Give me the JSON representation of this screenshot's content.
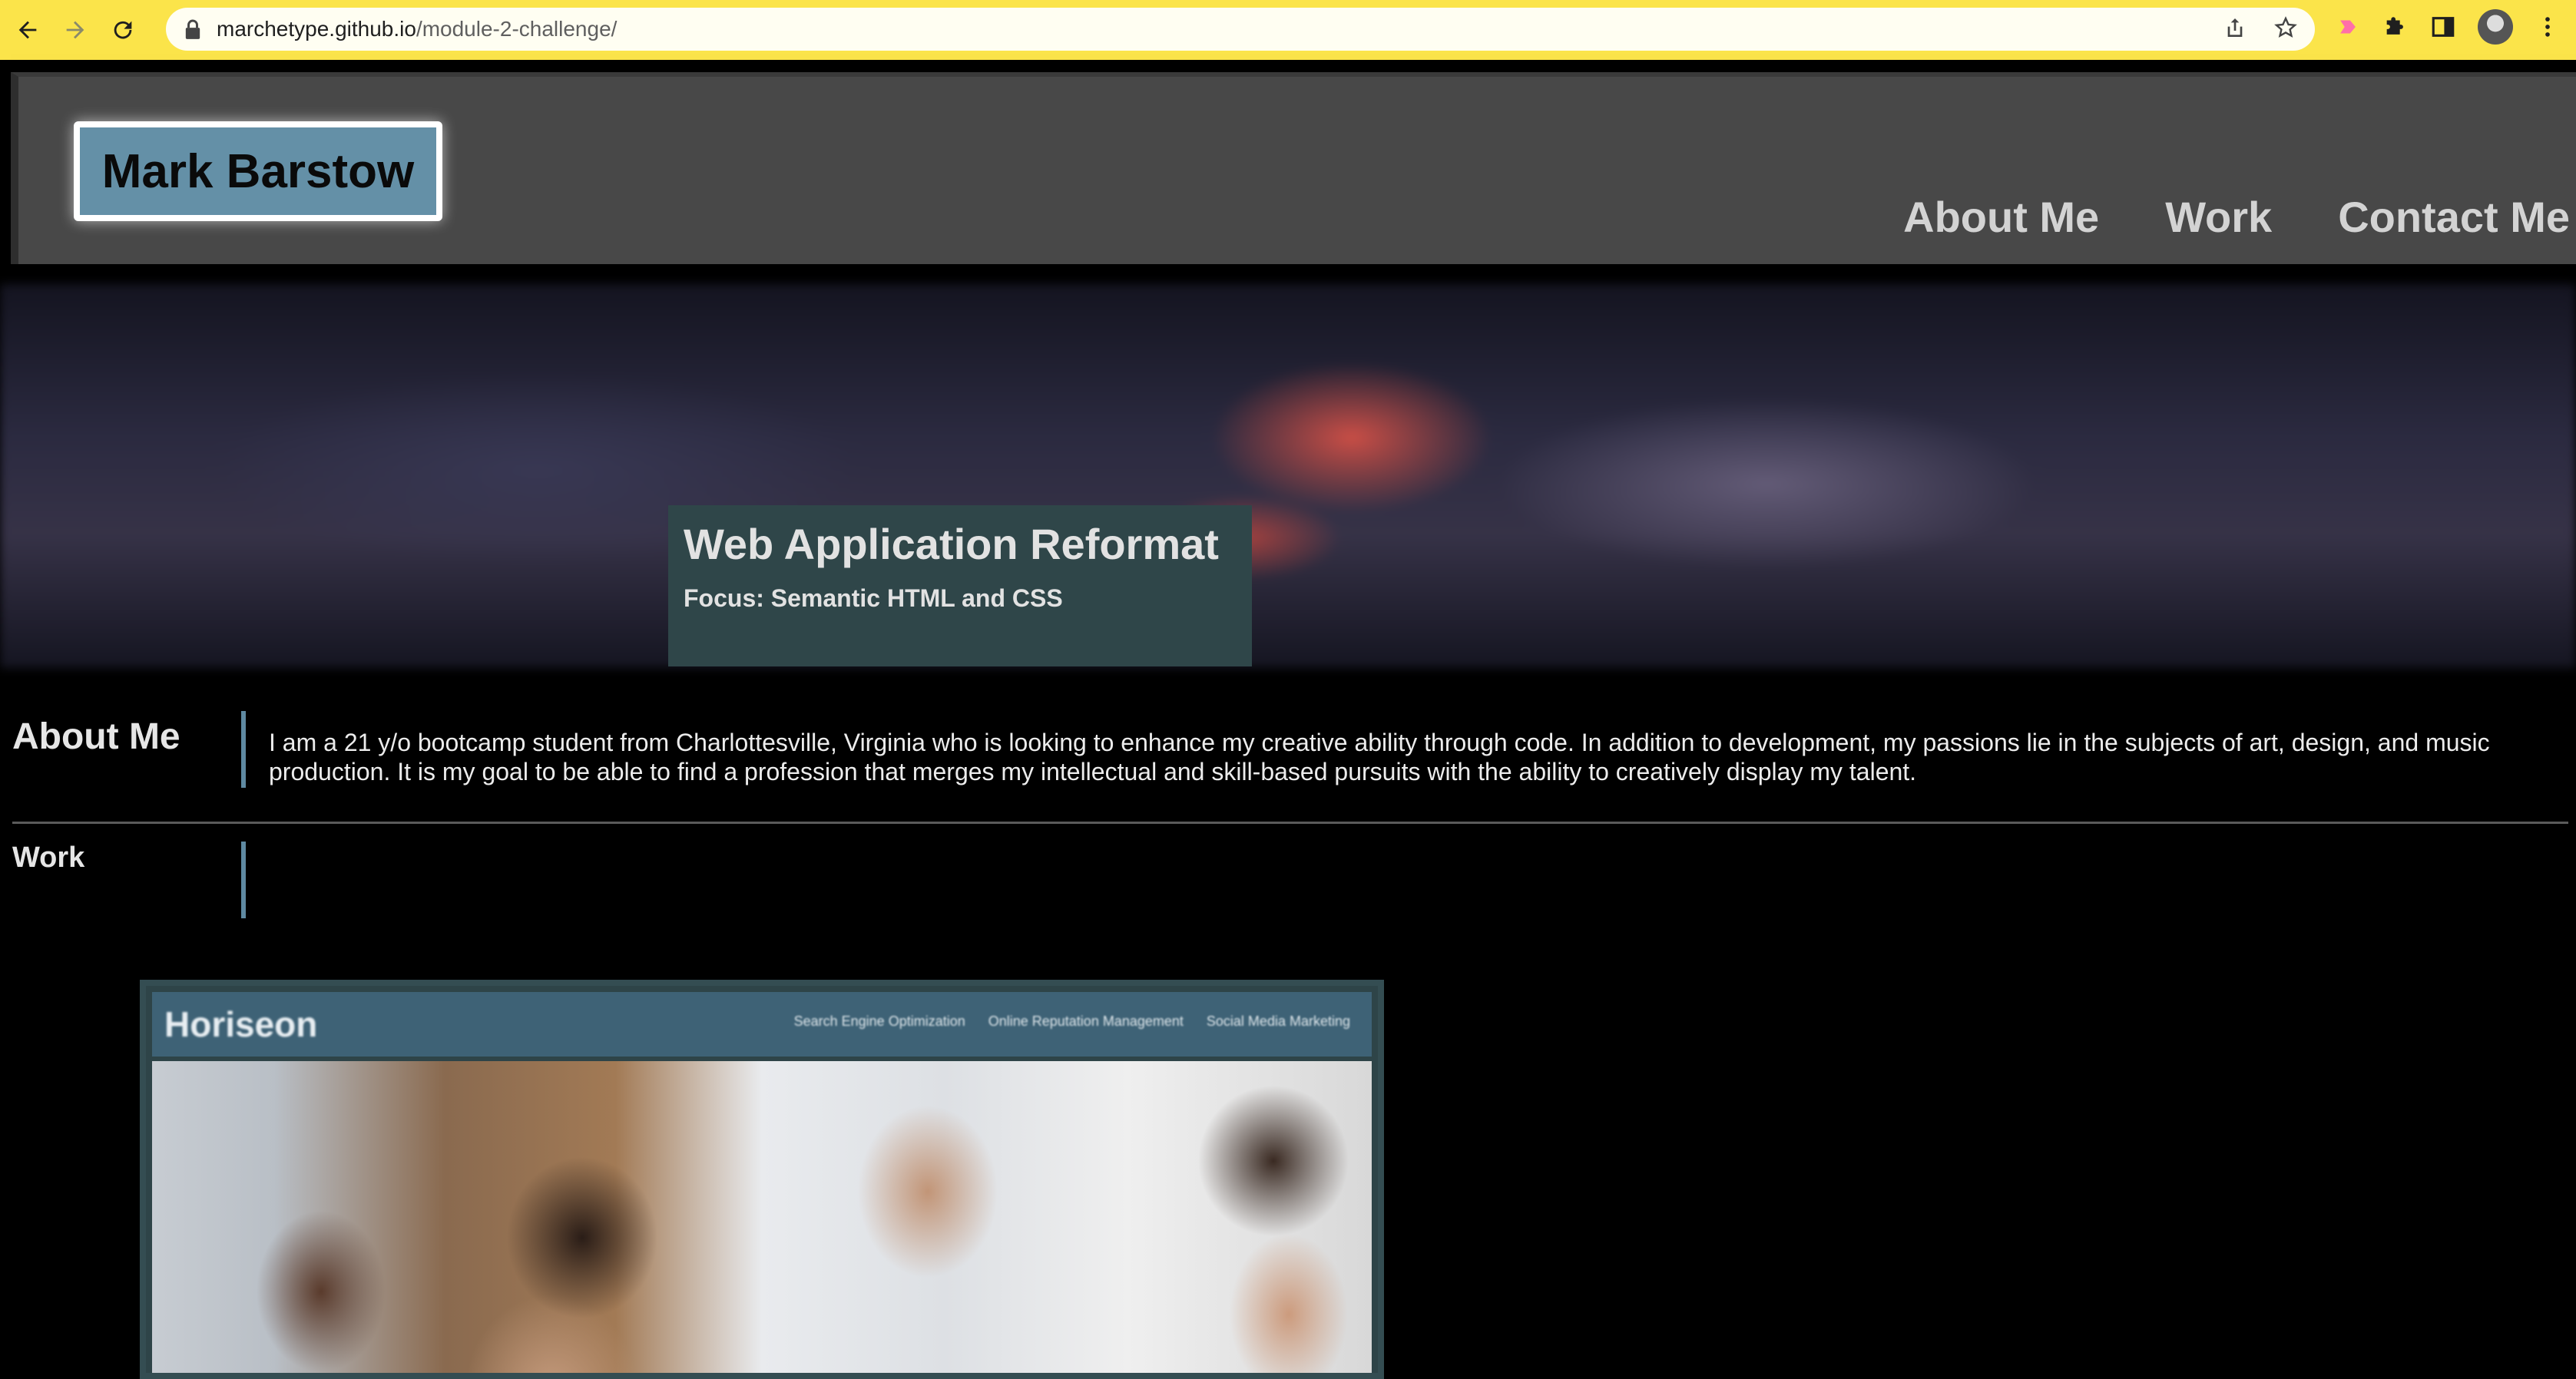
{
  "browser": {
    "url_host": "marchetype.github.io",
    "url_path": "/module-2-challenge/",
    "toolbar_color": "#fbe44a",
    "icons": [
      "back-icon",
      "forward-icon",
      "reload-icon",
      "lock-icon",
      "share-icon",
      "star-icon",
      "extension-icon",
      "puzzle-icon",
      "sidebar-icon",
      "profile-avatar",
      "menu-icon"
    ]
  },
  "site": {
    "logo_text": "Mark Barstow",
    "nav": [
      {
        "label": "About Me"
      },
      {
        "label": "Work"
      },
      {
        "label": "Contact Me"
      }
    ],
    "colors": {
      "accent": "#6490a7",
      "header_bg": "#484848",
      "page_bg": "#000000"
    }
  },
  "about": {
    "title": "About Me",
    "text": "I am a 21 y/o bootcamp student from Charlottesville, Virginia who is looking to enhance my creative ability through code. In addition to development, my passions lie in the subjects of art, design, and music production. It is my goal to be able to find a profession that merges my intellectual and skill-based pursuits with the ability to creatively display my talent."
  },
  "work": {
    "title": "Work",
    "project": {
      "screenshot_logo": "Horiseon",
      "screenshot_nav": [
        "Search Engine Optimization",
        "Online Reputation Management",
        "Social Media Marketing"
      ],
      "title": "Web Application Reformat",
      "subtitle": "Focus: Semantic HTML and CSS"
    }
  }
}
